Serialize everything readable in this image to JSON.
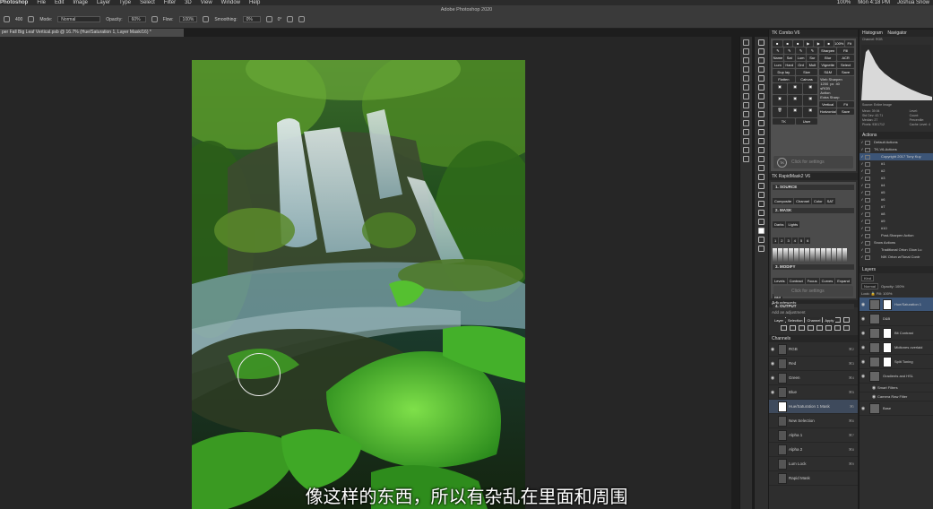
{
  "menubar": {
    "app": "Photoshop",
    "items": [
      "File",
      "Edit",
      "Image",
      "Layer",
      "Type",
      "Select",
      "Filter",
      "3D",
      "View",
      "Window",
      "Help"
    ],
    "right": [
      "100%",
      "Mon 4:18 PM",
      "Joshua Snow"
    ]
  },
  "window_title": "Adobe Photoshop 2020",
  "options": {
    "mode_label": "Mode:",
    "mode_value": "Normal",
    "opacity_label": "Opacity:",
    "opacity_value": "60%",
    "flow_label": "Flow:",
    "flow_value": "100%",
    "smoothing_label": "Smoothing:",
    "smoothing_value": "0%",
    "angle_value": "0°",
    "brush_size": "400"
  },
  "document_tab": "per Fall Big Leaf Vertical.psb @ 16.7% (Hue/Saturation 1, Layer Mask/16) *",
  "subtitle": "像这样的东西，所以有杂乱在里面和周围",
  "tk_combo": {
    "title": "TK Combo V6",
    "zoom": "100%",
    "fit": "Fit",
    "rows": [
      [
        "Name",
        "Sat",
        "Lum",
        "Sur"
      ],
      [
        "Lum",
        "Hard",
        "Ord",
        "Mult"
      ],
      [
        "Dup lay",
        "Size"
      ],
      [
        "Flatten",
        "Cairvas"
      ]
    ],
    "right_buttons": [
      "Sharpen",
      "Fill",
      "Blur",
      "ACR",
      "Vignette",
      "Select",
      "S&M",
      "Save"
    ],
    "web_sharpen_label": "Web Sharpen",
    "web_width": "1200",
    "web_unit": "px",
    "web_amount": "40",
    "checks": [
      "sRGB",
      "Action",
      "Extra Sharp"
    ],
    "orient": [
      "Vertical",
      "Fit",
      "Horizontal",
      "Save"
    ],
    "tk_label": "TK",
    "user_label": "User",
    "settings_text": "Click for settings"
  },
  "tk_rapid": {
    "title": "TK RapidMask2 V6",
    "source_label": "1. SOURCE",
    "source_buttons": [
      "Composite",
      "Channel",
      "Color",
      "SAT"
    ],
    "mask_label": "2. MASK",
    "mask_buttons": [
      "Darks",
      "Lights"
    ],
    "numbers": [
      "1",
      "2",
      "3",
      "4",
      "5",
      "6"
    ],
    "modify_label": "3. MODIFY",
    "modify_buttons": [
      "Levels",
      "Contract",
      "Focus",
      "Curves",
      "Expand",
      "Blur"
    ],
    "output_label": "4. OUTPUT",
    "output_buttons": [
      "Layer",
      "Selection",
      "Channel",
      "Apply"
    ],
    "settings_text": "Click for settings"
  },
  "adjustments": {
    "title": "Adjustments",
    "hint": "Add an adjustment"
  },
  "channels": {
    "title": "Channels",
    "rows": [
      {
        "name": "RGB",
        "shortcut": "⌘2"
      },
      {
        "name": "Red",
        "shortcut": "⌘3"
      },
      {
        "name": "Green",
        "shortcut": "⌘4"
      },
      {
        "name": "Blue",
        "shortcut": "⌘5"
      },
      {
        "name": "Hue/Saturation 1 Mask",
        "shortcut": "⌘\\"
      },
      {
        "name": "New Selection",
        "shortcut": "⌘6"
      },
      {
        "name": "Alpha 1",
        "shortcut": "⌘7"
      },
      {
        "name": "Alpha 2",
        "shortcut": "⌘8"
      },
      {
        "name": "Lum Lock",
        "shortcut": "⌘9"
      },
      {
        "name": "Rapid Mask",
        "shortcut": ""
      }
    ]
  },
  "histogram": {
    "tabs": [
      "Histogram",
      "Navigator"
    ],
    "channel_label": "Channel:",
    "channel_value": "RGB",
    "source_label": "Source:",
    "source_value": "Entire Image",
    "stats_left": [
      "Mean: 39.94",
      "Std Dev: 42.71",
      "Median: 27",
      "Pixels: 9301712"
    ],
    "stats_right": [
      "Level:",
      "Count:",
      "Percentile:",
      "Cache Level: 4"
    ]
  },
  "actions": {
    "title": "Actions",
    "rows": [
      {
        "name": "Default Actions",
        "indent": 0,
        "sel": false
      },
      {
        "name": "TK-V6-Actions",
        "indent": 0,
        "sel": false
      },
      {
        "name": "Copyright 2017 Tony Kuy",
        "indent": 1,
        "sel": true
      },
      {
        "name": "#1",
        "indent": 1,
        "sel": false
      },
      {
        "name": "#2",
        "indent": 1,
        "sel": false
      },
      {
        "name": "#3",
        "indent": 1,
        "sel": false
      },
      {
        "name": "#4",
        "indent": 1,
        "sel": false
      },
      {
        "name": "#5",
        "indent": 1,
        "sel": false
      },
      {
        "name": "#6",
        "indent": 1,
        "sel": false
      },
      {
        "name": "#7",
        "indent": 1,
        "sel": false
      },
      {
        "name": "#8",
        "indent": 1,
        "sel": false
      },
      {
        "name": "#9",
        "indent": 1,
        "sel": false
      },
      {
        "name": "#10",
        "indent": 1,
        "sel": false
      },
      {
        "name": "Post-Sharpen Action",
        "indent": 1,
        "sel": false
      },
      {
        "name": "Snow Actions",
        "indent": 0,
        "sel": false
      },
      {
        "name": "Traditional Orton Glow Lu",
        "indent": 1,
        "sel": false
      },
      {
        "name": "NIK Orton w/Tonal Contr",
        "indent": 1,
        "sel": false
      }
    ]
  },
  "layers": {
    "title": "Layers",
    "kind_label": "Kind",
    "blend": "Normal",
    "opacity_label": "Opacity:",
    "opacity_value": "100%",
    "lock_label": "Lock:",
    "fill_label": "Fill:",
    "fill_value": "100%",
    "rows": [
      {
        "name": "Hue/Saturation 1",
        "sel": true
      },
      {
        "name": "D&B",
        "sel": false
      },
      {
        "name": "Bit Contrast",
        "sel": false
      },
      {
        "name": "Midtones overlaid",
        "sel": false
      },
      {
        "name": "Split Toning",
        "sel": false
      },
      {
        "name": "Gradients and HSL",
        "sel": false
      },
      {
        "name": "Smart Filters",
        "sel": false
      },
      {
        "name": "Camera Raw Filter",
        "sel": false
      },
      {
        "name": "Base",
        "sel": false
      }
    ]
  }
}
